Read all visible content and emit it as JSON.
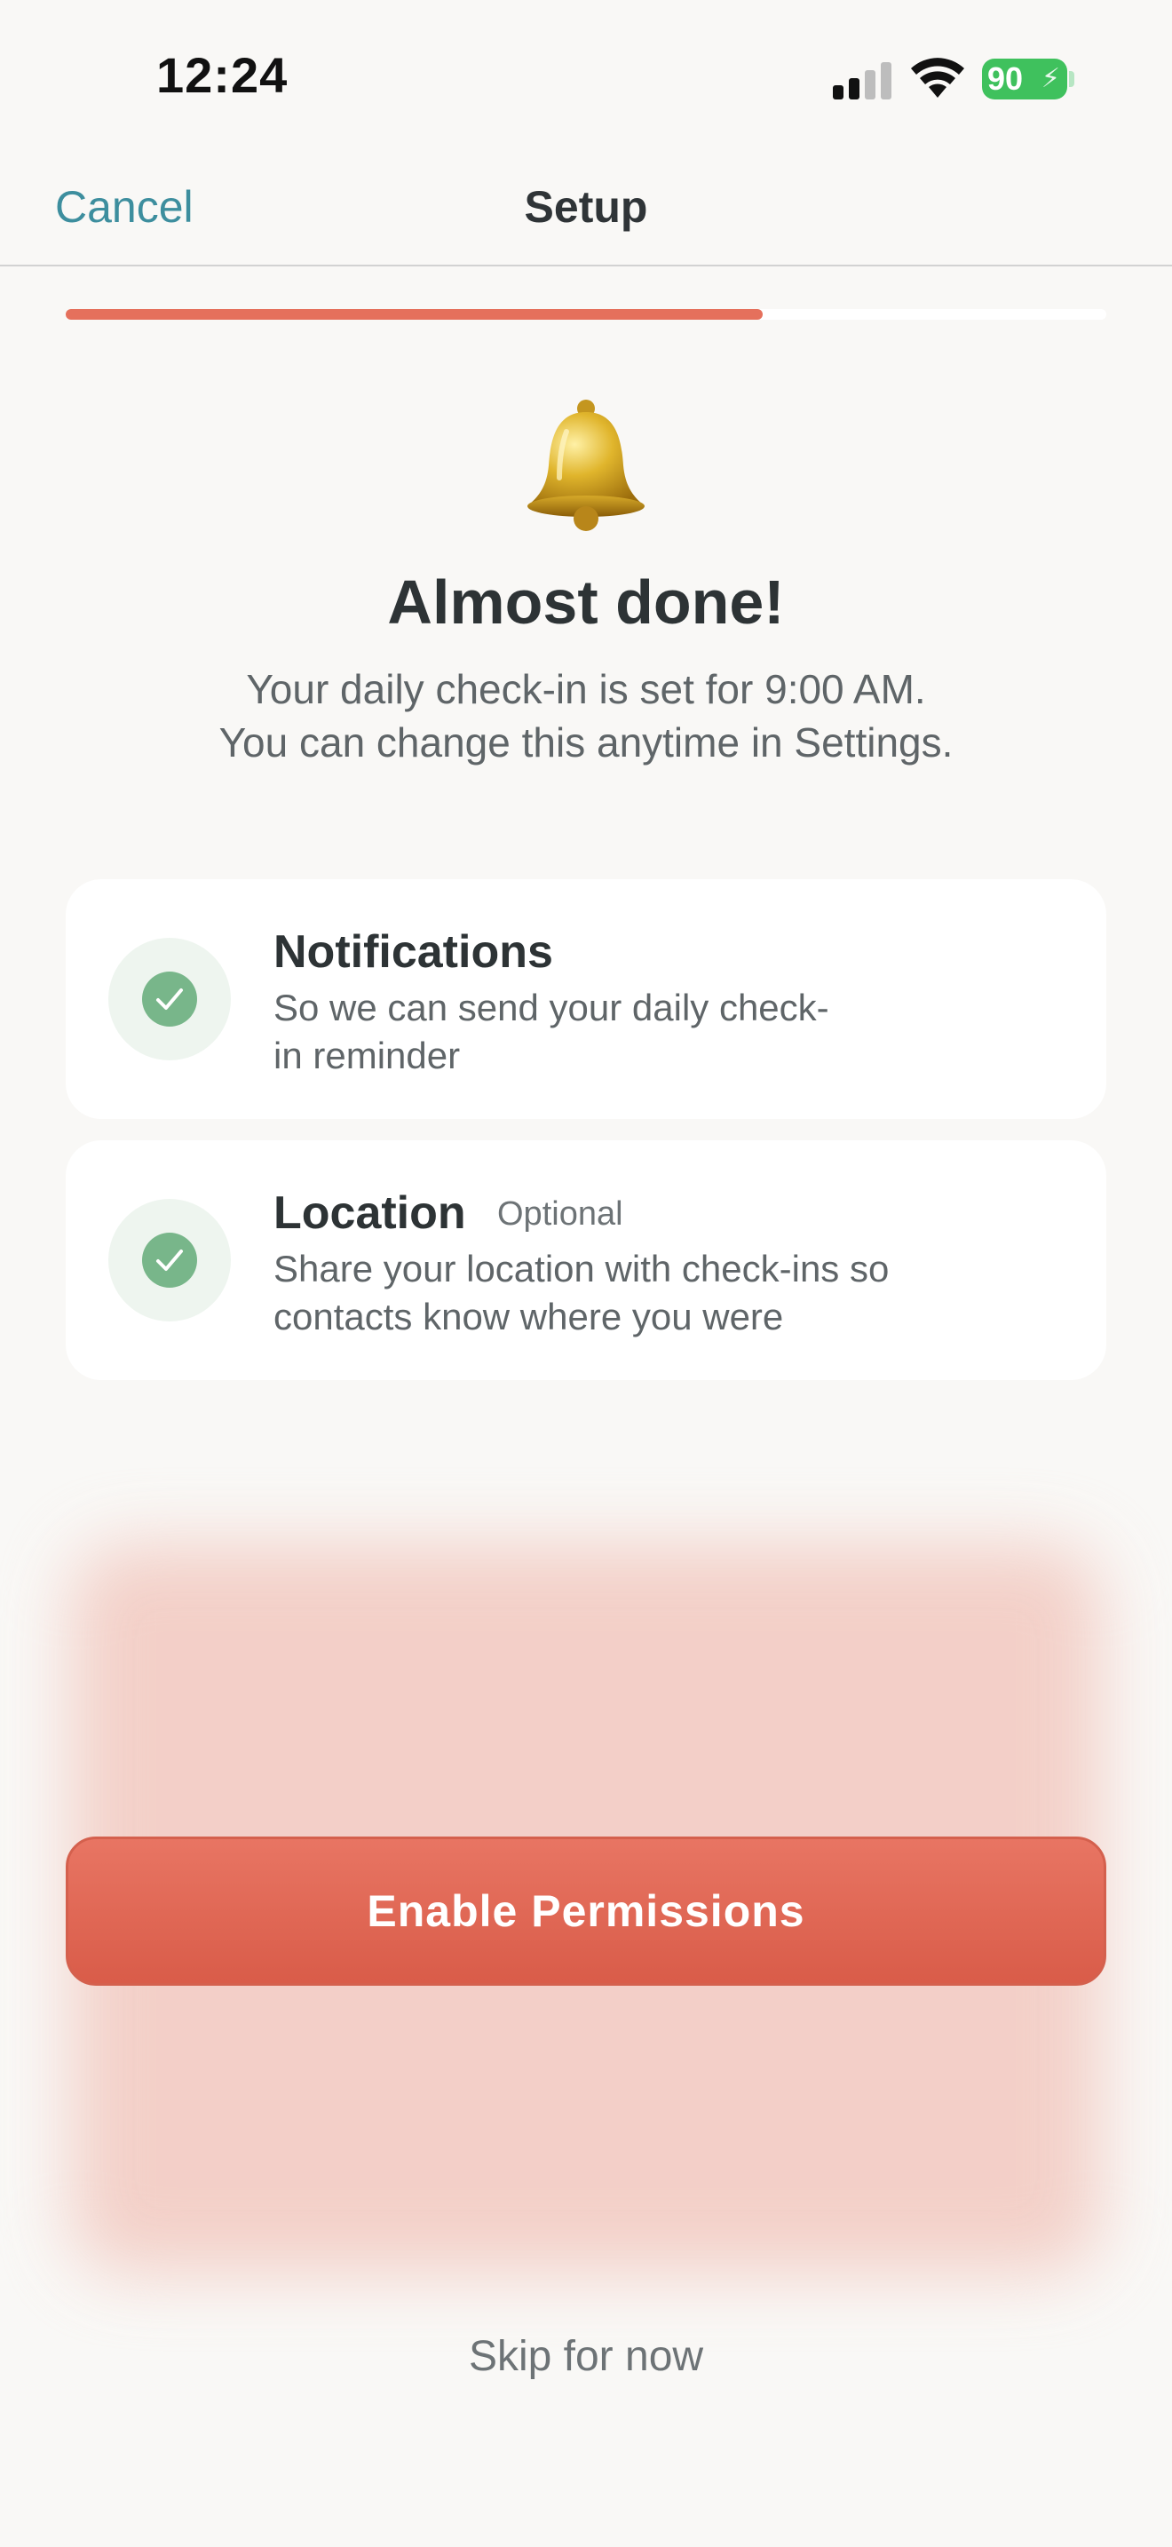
{
  "status_bar": {
    "time": "12:24",
    "battery_level": "90",
    "icons": [
      "cellular-signal-icon",
      "wifi-icon",
      "battery-charging-icon"
    ]
  },
  "nav": {
    "cancel_label": "Cancel",
    "title": "Setup"
  },
  "progress": {
    "value": 0.67
  },
  "hero": {
    "icon": "bell-icon",
    "headline": "Almost done!",
    "subtext_line1": "Your daily check-in is set for 9:00 AM.",
    "subtext_line2": "You can change this anytime in Settings."
  },
  "permissions": [
    {
      "title": "Notifications",
      "badge": "",
      "description_line1": "So we can send your daily check-",
      "description_line2": "in reminder",
      "granted": true
    },
    {
      "title": "Location",
      "badge": "Optional",
      "description_line1": "Share your location with check-ins so",
      "description_line2": "contacts know where you were",
      "granted": true
    }
  ],
  "actions": {
    "primary_label": "Enable Permissions",
    "secondary_label": "Skip for now"
  },
  "colors": {
    "accent": "#e5705c",
    "link": "#3d8e9e",
    "check": "#78b68a",
    "battery": "#3fc15d"
  }
}
